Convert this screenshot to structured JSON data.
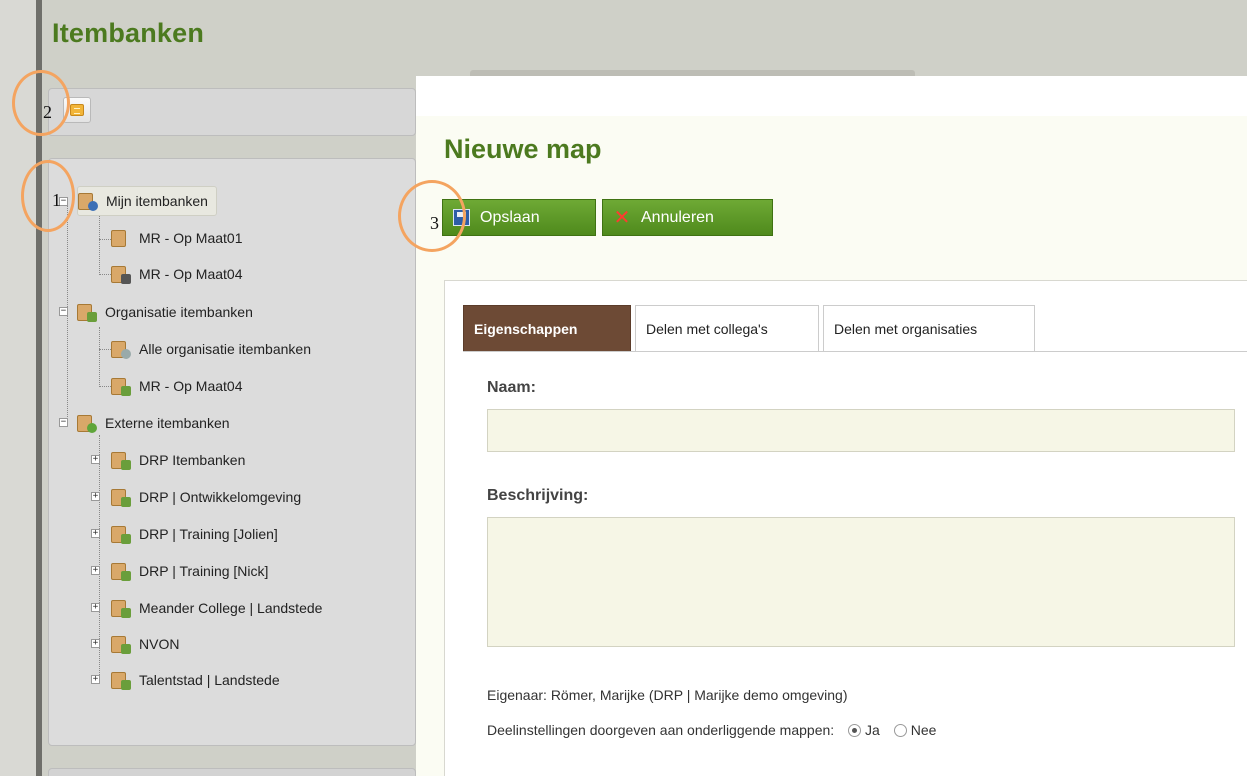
{
  "app": {
    "title": "Itembanken"
  },
  "tree": {
    "items": [
      {
        "label": "Mijn itembanken"
      },
      {
        "label": "MR - Op Maat01"
      },
      {
        "label": "MR - Op Maat04"
      },
      {
        "label": "Organisatie itembanken"
      },
      {
        "label": "Alle organisatie itembanken"
      },
      {
        "label": "MR - Op Maat04"
      },
      {
        "label": "Externe itembanken"
      },
      {
        "label": "DRP Itembanken"
      },
      {
        "label": "DRP | Ontwikkelomgeving"
      },
      {
        "label": "DRP | Training [Jolien]"
      },
      {
        "label": "DRP | Training [Nick]"
      },
      {
        "label": "Meander College | Landstede"
      },
      {
        "label": "NVON"
      },
      {
        "label": "Talentstad | Landstede"
      }
    ]
  },
  "main": {
    "title": "Nieuwe map",
    "save_label": "Opslaan",
    "cancel_label": "Annuleren",
    "tabs": [
      {
        "label": "Eigenschappen"
      },
      {
        "label": "Delen met collega's"
      },
      {
        "label": "Delen met organisaties"
      }
    ],
    "name_label": "Naam:",
    "name_value": "",
    "description_label": "Beschrijving:",
    "description_value": "",
    "owner_text": "Eigenaar:  Römer, Marijke (DRP | Marijke demo omgeving)",
    "share_settings_label": "Deelinstellingen doorgeven aan onderliggende mappen:",
    "option_yes": "Ja",
    "option_no": "Nee",
    "selected_option": "Ja"
  },
  "annotations": [
    "2",
    "1",
    "3"
  ],
  "icons": {
    "folder": "folder-icon",
    "save": "save-icon",
    "cancel": "cancel-icon"
  }
}
